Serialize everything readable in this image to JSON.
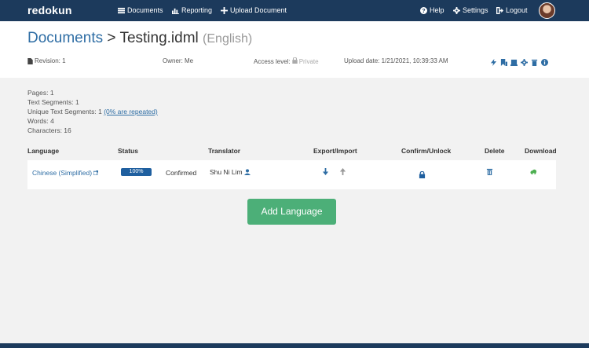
{
  "nav": {
    "brand": "redokun",
    "items": [
      {
        "label": "Documents",
        "icon": "list-icon"
      },
      {
        "label": "Reporting",
        "icon": "bar-chart-icon"
      },
      {
        "label": "Upload Document",
        "icon": "plus-icon"
      },
      {
        "label": "Help",
        "icon": "question-icon"
      },
      {
        "label": "Settings",
        "icon": "gear-icon"
      },
      {
        "label": "Logout",
        "icon": "logout-icon"
      }
    ],
    "colors": {
      "bar": "#1c3a5c",
      "text": "#ffffff"
    }
  },
  "header": {
    "breadcrumb": "Documents",
    "separator": ">",
    "filename": "Testing.idml",
    "language": "(English)"
  },
  "meta": {
    "revision": "Revision: 1",
    "owner": "Owner: Me",
    "access_label": "Access level:",
    "access_value": "Private",
    "upload_date": "Upload date: 1/21/2021, 10:39:33 AM"
  },
  "tools": [
    "bolt-icon",
    "bookmark-icon",
    "book-icon",
    "gear-icon",
    "trash-icon",
    "info-icon"
  ],
  "stats": {
    "pages": "Pages: 1",
    "segments": "Text Segments: 1",
    "unique": "Unique Text Segments: 1",
    "repeated": "(0% are repeated)",
    "words": "Words: 4",
    "characters": "Characters: 16"
  },
  "table": {
    "headers": {
      "language": "Language",
      "status": "Status",
      "translator": "Translator",
      "export_import": "Export/Import",
      "confirm_unlock": "Confirm/Unlock",
      "delete": "Delete",
      "download": "Download"
    },
    "rows": [
      {
        "language": "Chinese (Simplified)",
        "progress": "100%",
        "progress_value": 100,
        "status": "Confirmed",
        "translator": "Shu Ni Lim"
      }
    ]
  },
  "actions": {
    "add_language": "Add Language"
  },
  "colors": {
    "accent": "#2e6da4",
    "add_button": "#4caf78",
    "progress": "#1f5f9f",
    "download": "#4caf50"
  }
}
